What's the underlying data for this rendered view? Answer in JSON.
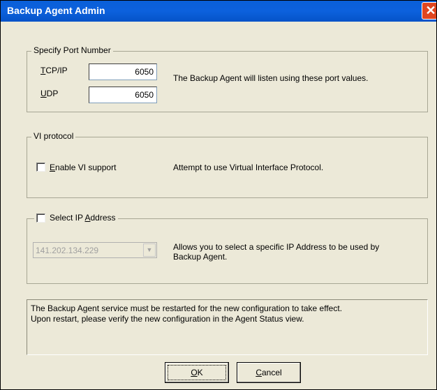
{
  "window": {
    "title": "Backup Agent Admin",
    "close_glyph": "✕"
  },
  "port_group": {
    "legend": "Specify Port Number",
    "tcp_label_mnemonic": "T",
    "tcp_label_rest": "CP/IP",
    "tcp_value": "6050",
    "udp_label_mnemonic": "U",
    "udp_label_rest": "DP",
    "udp_value": "6050",
    "description": "The Backup Agent will listen using these port values."
  },
  "vi_group": {
    "legend": "VI protocol",
    "checkbox_mnemonic": "E",
    "checkbox_rest": "nable VI support",
    "description": "Attempt to use Virtual Interface Protocol."
  },
  "ip_group": {
    "legend_pre": "Select IP ",
    "legend_mnemonic": "A",
    "legend_rest": "ddress",
    "selected_ip": "141.202.134.229",
    "description_line1": "Allows you to select a specific IP Address to be used by",
    "description_line2": "Backup Agent."
  },
  "info": {
    "line1": "The Backup Agent service must be restarted for the new configuration to take effect.",
    "line2": "Upon restart,  please verify the new configuration in the Agent Status view."
  },
  "buttons": {
    "ok_mnemonic": "O",
    "ok_rest": "K",
    "cancel_mnemonic": "C",
    "cancel_rest": "ancel"
  }
}
